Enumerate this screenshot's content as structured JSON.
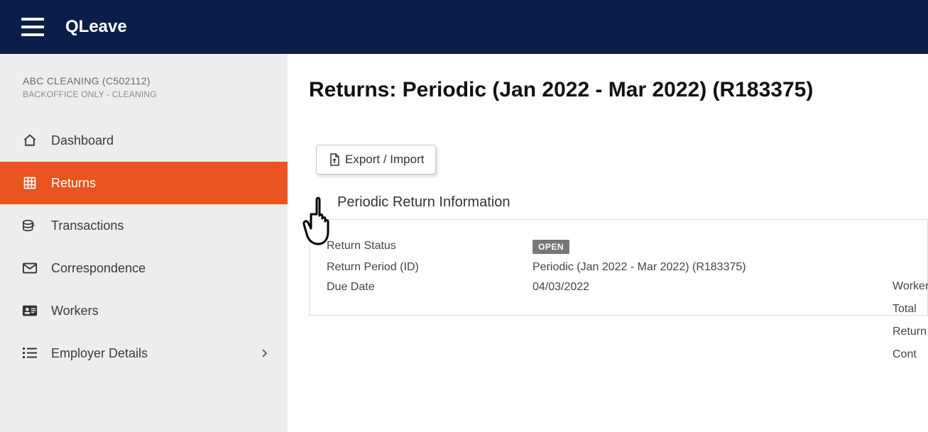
{
  "header": {
    "brand": "QLeave"
  },
  "sidebar": {
    "org_name": "ABC CLEANING (C502112)",
    "org_sub": "BACKOFFICE ONLY - CLEANING",
    "items": [
      {
        "label": "Dashboard"
      },
      {
        "label": "Returns"
      },
      {
        "label": "Transactions"
      },
      {
        "label": "Correspondence"
      },
      {
        "label": "Workers"
      },
      {
        "label": "Employer Details"
      }
    ]
  },
  "main": {
    "page_title": "Returns: Periodic (Jan 2022 - Mar 2022) (R183375)",
    "export_label": "Export / Import",
    "section_title": "Periodic Return Information",
    "info": {
      "status_label": "Return Status",
      "status_value": "OPEN",
      "period_label": "Return Period (ID)",
      "period_value": "Periodic (Jan 2022 - Mar 2022) (R183375)",
      "due_label": "Due Date",
      "due_value": "04/03/2022"
    },
    "right_labels": [
      "Workers",
      "Total",
      "Return",
      "Cont"
    ]
  }
}
